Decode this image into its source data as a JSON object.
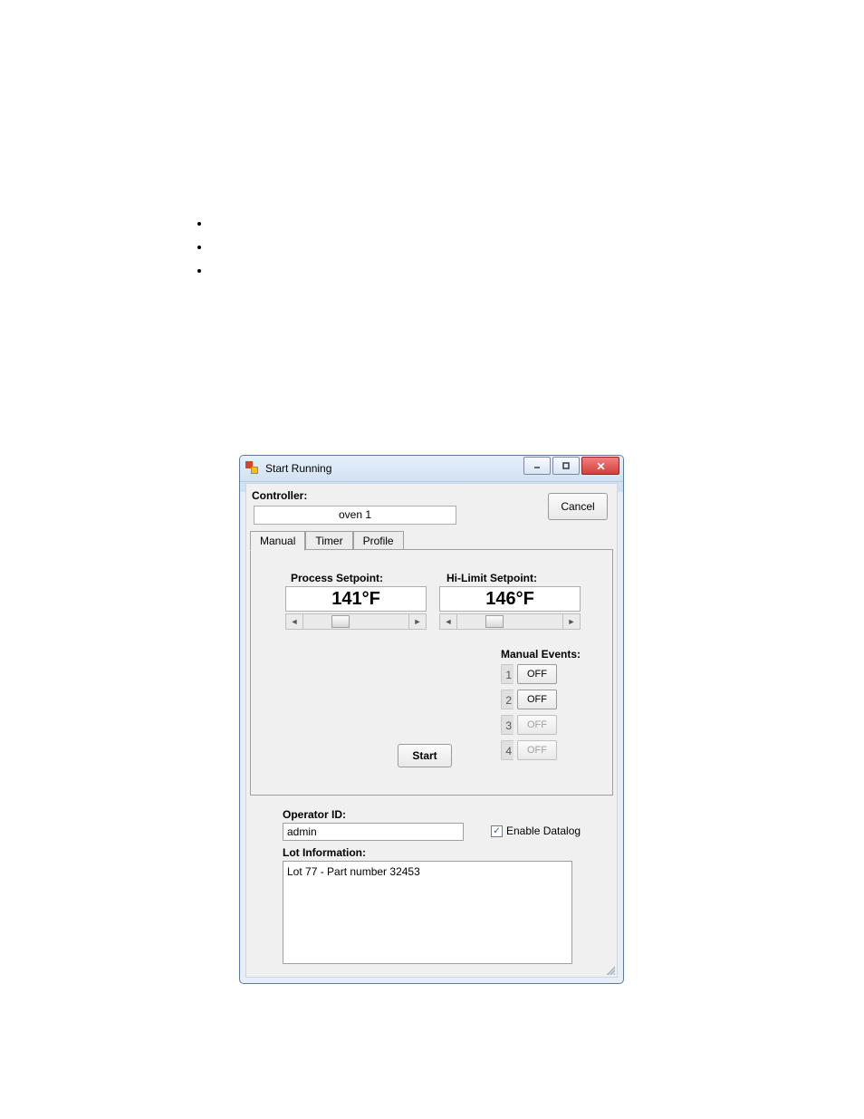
{
  "window": {
    "title": "Start Running",
    "cancel": "Cancel"
  },
  "controller": {
    "label": "Controller:",
    "value": "oven 1"
  },
  "tabs": {
    "manual": "Manual",
    "timer": "Timer",
    "profile": "Profile",
    "active": "manual"
  },
  "manual": {
    "process_label": "Process Setpoint:",
    "process_value": "141°F",
    "hilimit_label": "Hi-Limit Setpoint:",
    "hilimit_value": "146°F",
    "events_label": "Manual Events:",
    "events": [
      {
        "num": "1",
        "state": "OFF",
        "enabled": true
      },
      {
        "num": "2",
        "state": "OFF",
        "enabled": true
      },
      {
        "num": "3",
        "state": "OFF",
        "enabled": false
      },
      {
        "num": "4",
        "state": "OFF",
        "enabled": false
      }
    ],
    "start": "Start"
  },
  "operator": {
    "label": "Operator ID:",
    "value": "admin"
  },
  "datalog": {
    "label": "Enable Datalog",
    "checked": true
  },
  "lot": {
    "label": "Lot Information:",
    "value": "Lot 77 - Part number 32453"
  }
}
